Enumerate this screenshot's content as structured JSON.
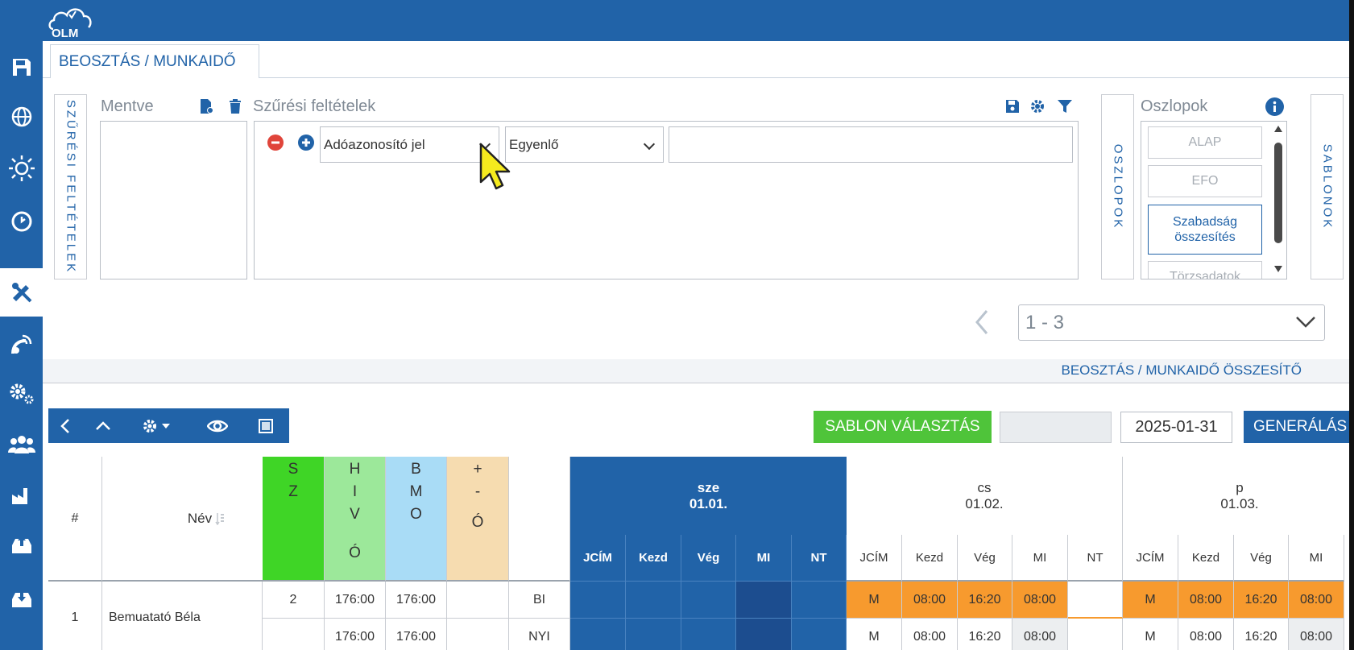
{
  "app": {
    "logo_text": "OLM"
  },
  "sidebar": {
    "items": [
      {
        "icon": "save-icon"
      },
      {
        "icon": "globe-icon"
      },
      {
        "icon": "sun-icon"
      },
      {
        "icon": "clock-icon"
      },
      {
        "icon": "tools-icon",
        "active": true
      },
      {
        "icon": "satellite-icon"
      },
      {
        "icon": "gears-icon"
      },
      {
        "icon": "users-icon"
      },
      {
        "icon": "factory-icon"
      },
      {
        "icon": "inbox-upload-icon"
      },
      {
        "icon": "inbox-download-icon"
      }
    ]
  },
  "tab": {
    "label": "BEOSZTÁS / MUNKAIDŐ"
  },
  "filter": {
    "vertical_label": "SZŰRÉSI FELTÉTELEK",
    "saved_label": "Mentve",
    "conditions_label": "Szűrési feltételek",
    "field_value": "Adóazonosító jel",
    "operator_value": "Egyenlő",
    "value_input": ""
  },
  "columns": {
    "vertical_label": "OSZLOPOK",
    "title": "Oszlopok",
    "buttons": [
      "ALAP",
      "EFO",
      "Szabadság összesítés",
      "Törzsadatok"
    ],
    "templates_vertical_label": "SABLONOK"
  },
  "pager": {
    "value": "1 - 3"
  },
  "section": {
    "title": "BEOSZTÁS / MUNKAIDŐ ÖSSZESÍTŐ"
  },
  "actions": {
    "template_button": "SABLON VÁLASZTÁS",
    "date_value": "2025-01-31",
    "generate_button": "GENERÁLÁS"
  },
  "table": {
    "hash": "#",
    "name_header": "Név",
    "sz": [
      "S",
      "Z"
    ],
    "hivo": [
      "H",
      "I",
      "V",
      "Ó"
    ],
    "bmo": [
      "B",
      "M",
      "O"
    ],
    "plusmino": [
      "+",
      "-",
      "Ó"
    ],
    "days": [
      {
        "day": "sze",
        "date": "01.01."
      },
      {
        "day": "cs",
        "date": "01.02."
      },
      {
        "day": "p",
        "date": "01.03."
      }
    ],
    "sub_headers": [
      "JCÍM",
      "Kezd",
      "Vég",
      "MI",
      "NT"
    ],
    "rows": [
      {
        "num": "1",
        "name": "Bemuatató Béla",
        "lines": [
          {
            "sz": "2",
            "hivo": "176:00",
            "bmo": "176:00",
            "pm": "",
            "type": "BI",
            "d2": [
              "M",
              "08:00",
              "16:20",
              "08:00",
              ""
            ],
            "d3": [
              "M",
              "08:00",
              "16:20",
              "08:00"
            ]
          },
          {
            "sz": "",
            "hivo": "176:00",
            "bmo": "176:00",
            "pm": "",
            "type": "NYI",
            "d2": [
              "M",
              "08:00",
              "16:20",
              "08:00",
              ""
            ],
            "d3": [
              "M",
              "08:00",
              "16:20",
              "08:00"
            ]
          }
        ]
      }
    ]
  }
}
